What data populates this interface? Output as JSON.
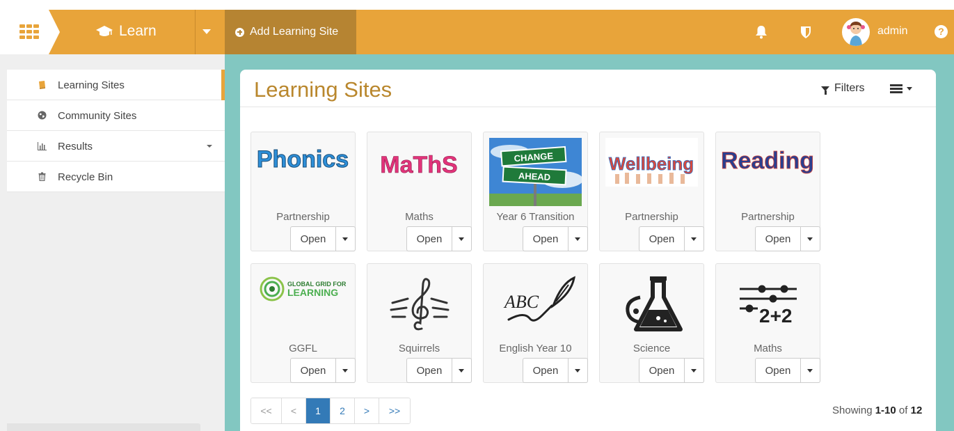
{
  "header": {
    "app_name": "Learn",
    "add_button": "Add Learning Site",
    "user_name": "admin",
    "help_glyph": "?",
    "icons": [
      "apps-grid-icon",
      "graduation-cap-icon",
      "caret-down-icon",
      "plus-circle-icon",
      "bell-icon",
      "shield-icon",
      "avatar",
      "help-icon"
    ]
  },
  "sidebar": {
    "items": [
      {
        "label": "Learning Sites",
        "icon": "book-icon",
        "active": true
      },
      {
        "label": "Community Sites",
        "icon": "globe-icon"
      },
      {
        "label": "Results",
        "icon": "bar-chart-icon",
        "has_caret": true
      },
      {
        "label": "Recycle Bin",
        "icon": "trash-icon"
      }
    ]
  },
  "main": {
    "title": "Learning Sites",
    "filters_label": "Filters",
    "open_label": "Open",
    "tiles": [
      {
        "title": "Partnership",
        "image_text": "Phonics"
      },
      {
        "title": "Maths",
        "image_text": "MaThS"
      },
      {
        "title": "Year 6 Transition",
        "image_text_1": "CHANGE",
        "image_text_2": "AHEAD"
      },
      {
        "title": "Partnership",
        "image_text": "Wellbeing"
      },
      {
        "title": "Partnership",
        "image_text": "Reading"
      },
      {
        "title": "GGFL",
        "image_text_1": "GLOBAL GRID FOR",
        "image_text_2": "LEARNING"
      },
      {
        "title": "Squirrels",
        "image_text": "music-clef-icon"
      },
      {
        "title": "English Year 10",
        "image_text": "ABC"
      },
      {
        "title": "Science",
        "image_text": "flask-icon"
      },
      {
        "title": "Maths",
        "image_text": "2+2"
      }
    ],
    "pagination": {
      "first": "<<",
      "prev": "<",
      "pages": [
        "1",
        "2"
      ],
      "current_page": "1",
      "next": ">",
      "last": ">>"
    },
    "showing": {
      "prefix": "Showing ",
      "range": "1-10",
      "of": " of ",
      "total": "12"
    }
  },
  "colors": {
    "header": "#e8a43a",
    "add_button": "#b68432",
    "title": "#b9872d",
    "teal_background": "#82c7c1",
    "pager_active": "#337ab7"
  }
}
